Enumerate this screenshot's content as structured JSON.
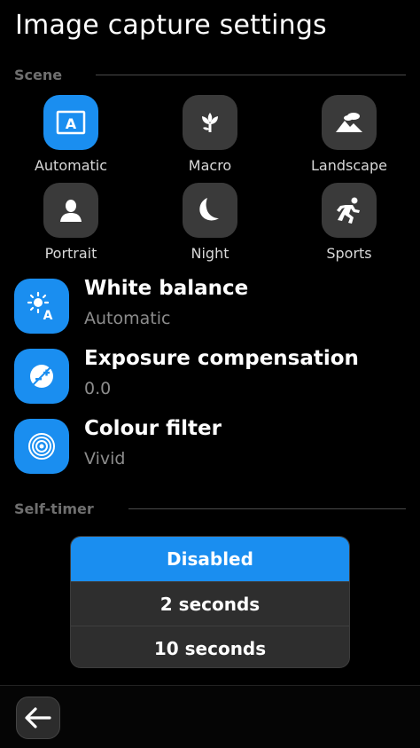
{
  "page": {
    "title": "Image capture settings"
  },
  "scene": {
    "header": "Scene",
    "items": [
      {
        "label": "Automatic",
        "icon": "auto-icon",
        "selected": true
      },
      {
        "label": "Macro",
        "icon": "flower-icon",
        "selected": false
      },
      {
        "label": "Landscape",
        "icon": "landscape-icon",
        "selected": false
      },
      {
        "label": "Portrait",
        "icon": "person-icon",
        "selected": false
      },
      {
        "label": "Night",
        "icon": "moon-icon",
        "selected": false
      },
      {
        "label": "Sports",
        "icon": "runner-icon",
        "selected": false
      }
    ]
  },
  "settings": [
    {
      "title": "White balance",
      "value": "Automatic",
      "icon": "white-balance-icon"
    },
    {
      "title": "Exposure compensation",
      "value": "0.0",
      "icon": "exposure-icon"
    },
    {
      "title": "Colour filter",
      "value": "Vivid",
      "icon": "colour-filter-icon"
    }
  ],
  "self_timer": {
    "header": "Self-timer",
    "options": [
      {
        "label": "Disabled",
        "selected": true
      },
      {
        "label": "2 seconds",
        "selected": false
      },
      {
        "label": "10 seconds",
        "selected": false
      }
    ]
  },
  "toolbar": {
    "back_icon": "back-arrow-icon"
  },
  "colors": {
    "accent": "#1a8ef0",
    "tile": "#3a3a3a",
    "background": "#000000"
  }
}
